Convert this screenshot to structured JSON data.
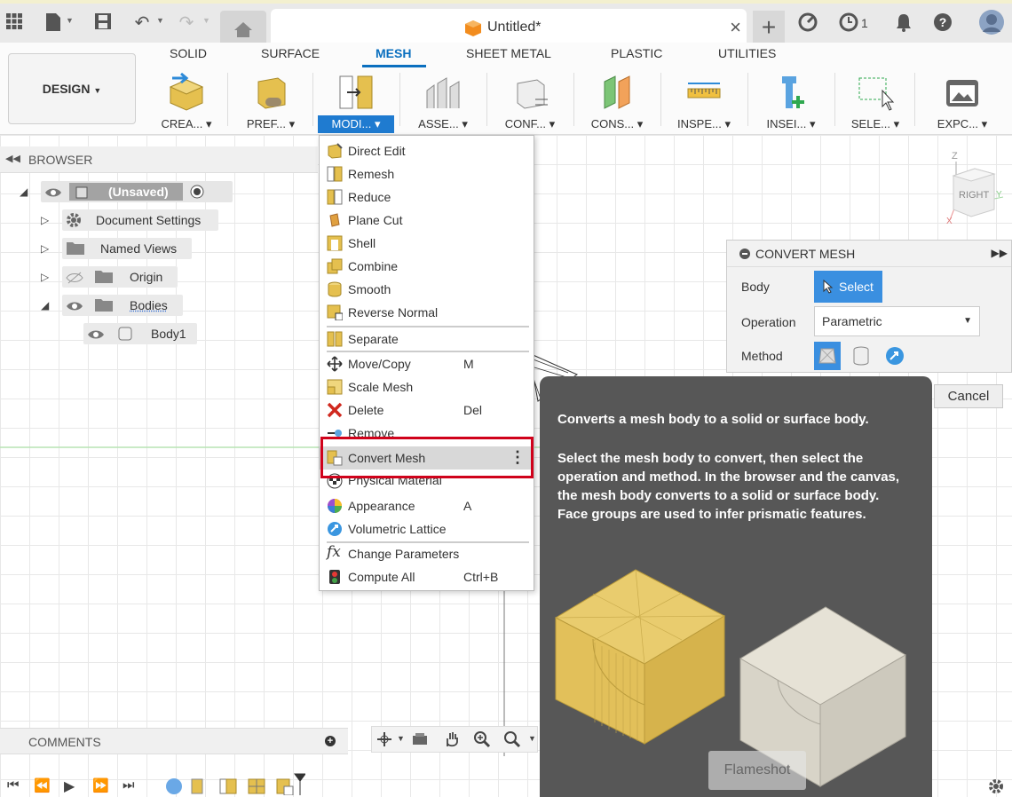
{
  "topbar": {
    "doc_title": "Untitled*",
    "notification_count": "1"
  },
  "ribbon": {
    "workspace": "DESIGN",
    "tabs": [
      "SOLID",
      "SURFACE",
      "MESH",
      "SHEET METAL",
      "PLASTIC",
      "UTILITIES"
    ],
    "active_tab": "MESH",
    "groups": [
      "CREA...",
      "PREF...",
      "MODI...",
      "ASSE...",
      "CONF...",
      "CONS...",
      "INSPE...",
      "INSEI...",
      "SELE...",
      "EXPC..."
    ]
  },
  "browser": {
    "title": "BROWSER",
    "items": [
      {
        "label": "(Unsaved)"
      },
      {
        "label": "Document Settings"
      },
      {
        "label": "Named Views"
      },
      {
        "label": "Origin"
      },
      {
        "label": "Bodies"
      },
      {
        "label": "Body1"
      }
    ]
  },
  "modify_menu": {
    "items": [
      {
        "label": "Direct Edit",
        "key": "",
        "icon": "direct-edit-icon"
      },
      {
        "label": "Remesh",
        "key": "",
        "icon": "remesh-icon"
      },
      {
        "label": "Reduce",
        "key": "",
        "icon": "reduce-icon"
      },
      {
        "label": "Plane Cut",
        "key": "",
        "icon": "plane-cut-icon"
      },
      {
        "label": "Shell",
        "key": "",
        "icon": "shell-icon"
      },
      {
        "label": "Combine",
        "key": "",
        "icon": "combine-icon"
      },
      {
        "label": "Smooth",
        "key": "",
        "icon": "smooth-icon"
      },
      {
        "label": "Reverse Normal",
        "key": "",
        "icon": "reverse-normal-icon"
      },
      {
        "label": "Separate",
        "key": "",
        "icon": "separate-icon"
      },
      {
        "label": "Move/Copy",
        "key": "M",
        "icon": "move-icon"
      },
      {
        "label": "Scale Mesh",
        "key": "",
        "icon": "scale-icon"
      },
      {
        "label": "Delete",
        "key": "Del",
        "icon": "delete-icon"
      },
      {
        "label": "Remove",
        "key": "",
        "icon": "remove-icon"
      },
      {
        "label": "Convert Mesh",
        "key": "",
        "icon": "convert-mesh-icon"
      },
      {
        "label": "Physical Material",
        "key": "",
        "icon": "physical-material-icon"
      },
      {
        "label": "Appearance",
        "key": "A",
        "icon": "appearance-icon"
      },
      {
        "label": "Volumetric Lattice",
        "key": "",
        "icon": "volumetric-lattice-icon"
      },
      {
        "label": "Change Parameters",
        "key": "",
        "icon": "fx-icon"
      },
      {
        "label": "Compute All",
        "key": "Ctrl+B",
        "icon": "compute-all-icon"
      }
    ]
  },
  "convert_panel": {
    "title": "CONVERT MESH",
    "body_label": "Body",
    "select_label": "Select",
    "operation_label": "Operation",
    "operation_value": "Parametric",
    "method_label": "Method",
    "cancel_label": "Cancel"
  },
  "tooltip": {
    "summary": "Converts a mesh body to a solid or surface body.",
    "details": "Select the mesh body to convert, then select the operation and method. In the browser and the canvas, the mesh body converts to a solid or surface body. Face groups are used to infer prismatic features."
  },
  "overlay": {
    "flameshot": "Flameshot"
  },
  "comments": {
    "title": "COMMENTS"
  },
  "viewcube": {
    "face": "RIGHT",
    "z": "Z",
    "y": "Y",
    "x": "X"
  },
  "colors": {
    "accent": "#1f7bd0",
    "highlight_outline": "#d0021b",
    "mesh_gold": "#e8c65a"
  }
}
